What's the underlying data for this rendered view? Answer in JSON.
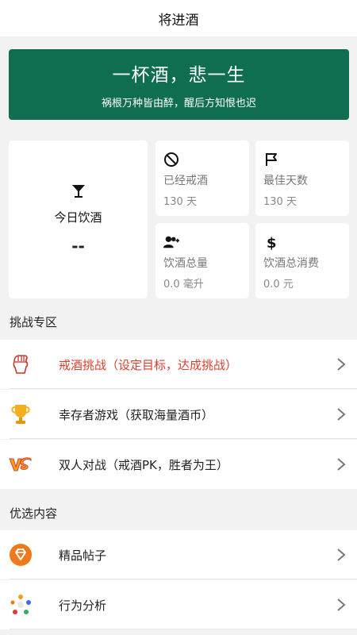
{
  "header": {
    "title": "将进酒"
  },
  "banner": {
    "title": "一杯酒，悲一生",
    "subtitle": "祸根万种皆由醉，醒后方知恨也迟"
  },
  "today": {
    "label": "今日饮酒",
    "value": "--",
    "icon": "cocktail-glass-icon"
  },
  "stats": [
    {
      "name": "已经戒酒",
      "value": "130 天",
      "icon": "ban-icon"
    },
    {
      "name": "最佳天数",
      "value": "130 天",
      "icon": "flag-icon"
    },
    {
      "name": "饮酒总量",
      "value": "0.0 毫升",
      "icon": "user-add-icon"
    },
    {
      "name": "饮酒总消费",
      "value": "0.0 元",
      "icon": "dollar-icon"
    }
  ],
  "challenge": {
    "title": "挑战专区",
    "items": [
      {
        "label": "戒酒挑战（设定目标，达成挑战）",
        "icon": "fist-icon",
        "color": "#d9412f"
      },
      {
        "label": "幸存者游戏（获取海量酒币）",
        "icon": "trophy-icon",
        "color": "#222222"
      },
      {
        "label": "双人对战（戒酒PK，胜者为王）",
        "icon": "vs-icon",
        "color": "#222222"
      }
    ]
  },
  "featured": {
    "title": "优选内容",
    "items": [
      {
        "label": "精品帖子",
        "icon": "diamond-badge-icon"
      },
      {
        "label": "行为分析",
        "icon": "dots-analysis-icon"
      }
    ]
  },
  "colors": {
    "brand": "#0f6e52",
    "accent_red": "#d9412f",
    "background": "#f2f2f2"
  }
}
